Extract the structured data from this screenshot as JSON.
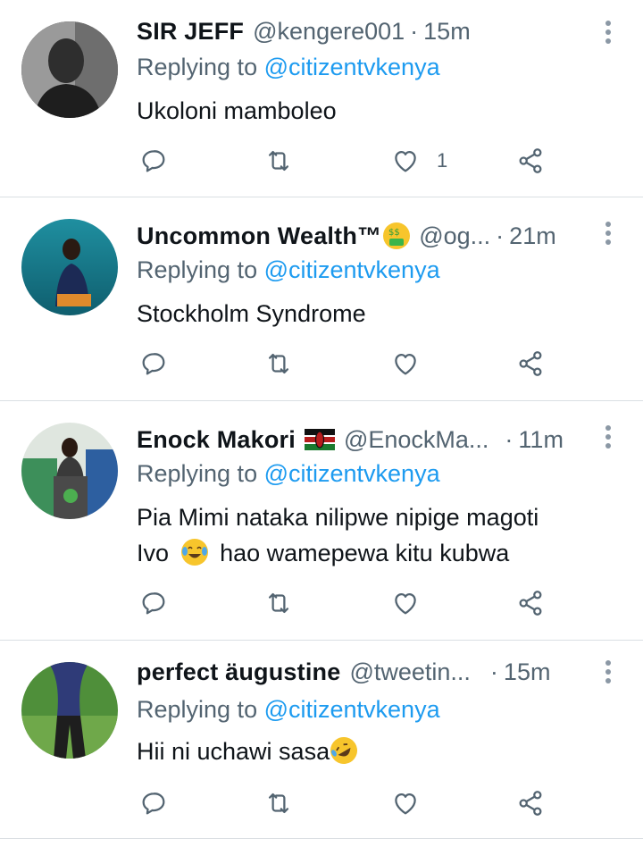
{
  "colors": {
    "accent": "#1d9bf0",
    "muted": "#536471",
    "text": "#0f1419",
    "divider": "#dadfe3"
  },
  "icons": {
    "reply": "reply-icon",
    "retweet": "retweet-icon",
    "like": "like-icon",
    "share": "share-icon",
    "more": "more-icon"
  },
  "tweets": [
    {
      "name": "SIR JEFF",
      "handle": "@kengere001",
      "sep": "·",
      "time": "15m",
      "replying_prefix": "Replying to ",
      "replying_to": "@citizentvkenya",
      "text": "Ukoloni mamboleo",
      "likes": "1"
    },
    {
      "name": "Uncommon Wealth™",
      "handle": "@og...",
      "sep": "·",
      "time": "21m",
      "replying_prefix": "Replying to ",
      "replying_to": "@citizentvkenya",
      "text": "Stockholm Syndrome",
      "name_emoji": "money-mouth-face"
    },
    {
      "name": "Enock Makori",
      "handle": "@EnockMa...",
      "sep": "·",
      "time": "11m",
      "replying_prefix": "Replying to ",
      "replying_to": "@citizentvkenya",
      "text_line1": "Pia Mimi nataka nilipwe nipige magoti",
      "text_line2a": "Ivo",
      "text_line2b": "hao wamepewa kitu kubwa",
      "name_emoji": "kenya-flag",
      "text_emoji": "tears-of-joy-face"
    },
    {
      "name": "perfect äugustine",
      "handle": "@tweetin...",
      "sep": "·",
      "time": "15m",
      "replying_prefix": "Replying to ",
      "replying_to": "@citizentvkenya",
      "text": "Hii ni uchawi sasa",
      "text_emoji": "rolling-laughing-face"
    }
  ]
}
